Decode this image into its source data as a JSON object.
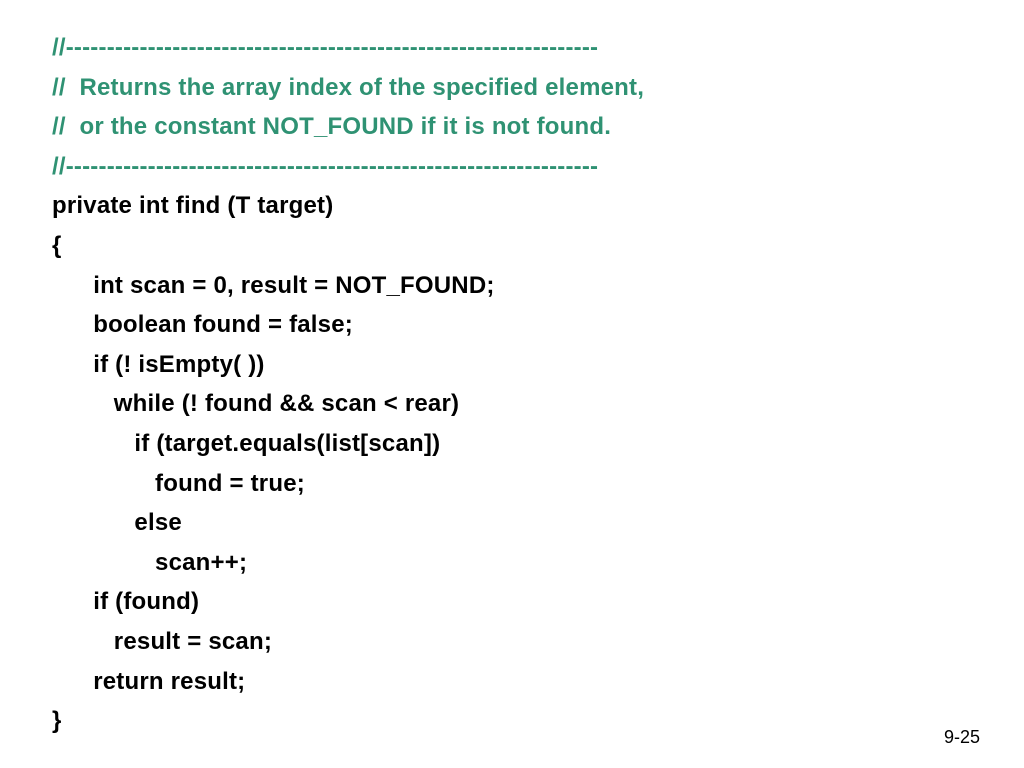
{
  "lines": [
    {
      "cls": "comment",
      "text": "//-----------------------------------------------------------------"
    },
    {
      "cls": "comment",
      "text": "//  Returns the array index of the specified element,"
    },
    {
      "cls": "comment",
      "text": "//  or the constant NOT_FOUND if it is not found."
    },
    {
      "cls": "comment",
      "text": "//-----------------------------------------------------------------"
    },
    {
      "cls": "code",
      "text": "private int find (T target)"
    },
    {
      "cls": "code",
      "text": "{"
    },
    {
      "cls": "code",
      "text": "      int scan = 0, result = NOT_FOUND;"
    },
    {
      "cls": "code",
      "text": "      boolean found = false;"
    },
    {
      "cls": "code",
      "text": "      if (! isEmpty( ))"
    },
    {
      "cls": "code",
      "text": "         while (! found && scan < rear)"
    },
    {
      "cls": "code",
      "text": "            if (target.equals(list[scan])"
    },
    {
      "cls": "code",
      "text": "               found = true;"
    },
    {
      "cls": "code",
      "text": "            else"
    },
    {
      "cls": "code",
      "text": "               scan++;"
    },
    {
      "cls": "code",
      "text": "      if (found)"
    },
    {
      "cls": "code",
      "text": "         result = scan;"
    },
    {
      "cls": "code",
      "text": "      return result;"
    },
    {
      "cls": "code",
      "text": "}"
    }
  ],
  "page_number": "9-25"
}
